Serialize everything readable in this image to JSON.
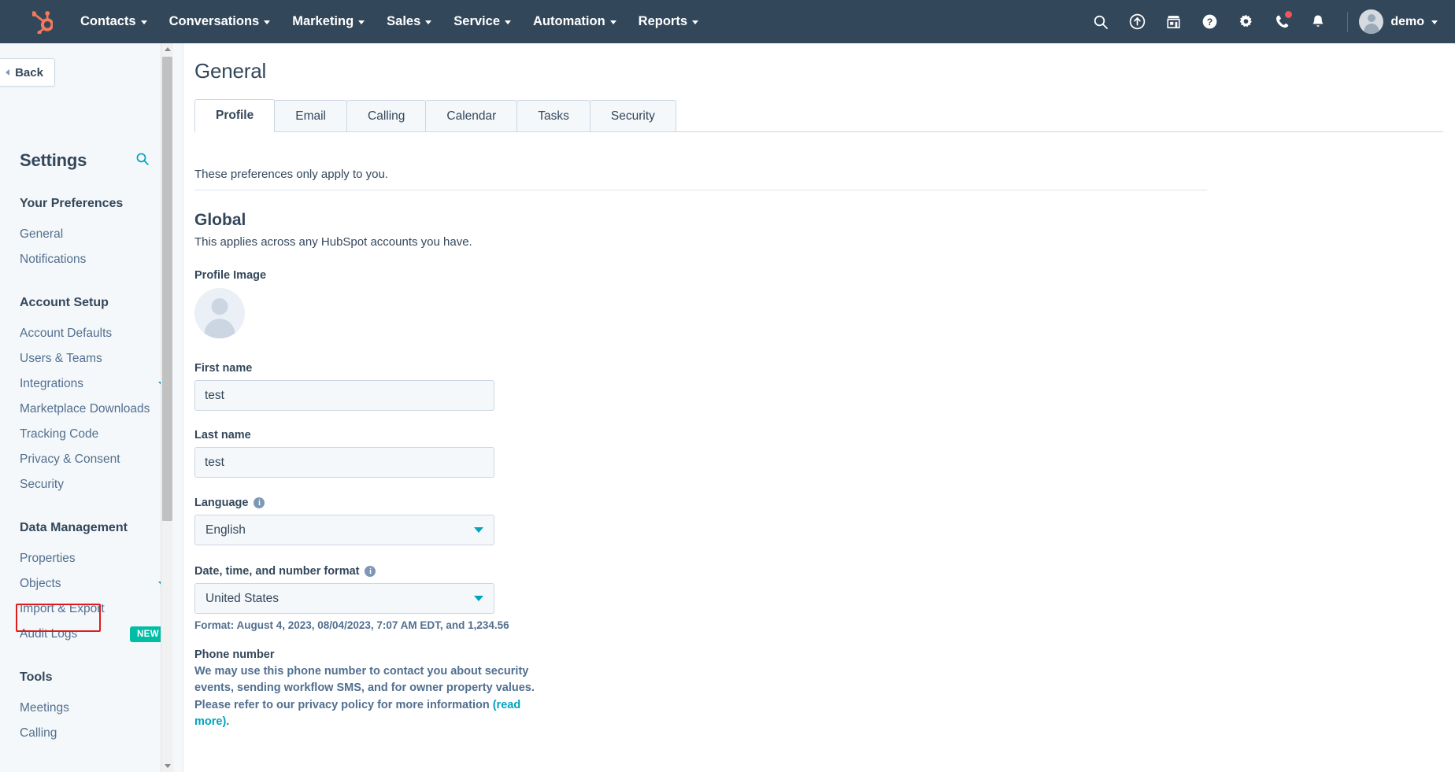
{
  "topnav": {
    "logo_icon": "hubspot-sprocket-logo",
    "items": [
      {
        "label": "Contacts",
        "icon": "chevron-down-icon"
      },
      {
        "label": "Conversations",
        "icon": "chevron-down-icon"
      },
      {
        "label": "Marketing",
        "icon": "chevron-down-icon"
      },
      {
        "label": "Sales",
        "icon": "chevron-down-icon"
      },
      {
        "label": "Service",
        "icon": "chevron-down-icon"
      },
      {
        "label": "Automation",
        "icon": "chevron-down-icon"
      },
      {
        "label": "Reports",
        "icon": "chevron-down-icon"
      }
    ],
    "right_icons": [
      {
        "name": "search-icon"
      },
      {
        "name": "upgrade-arrow-icon"
      },
      {
        "name": "marketplace-icon"
      },
      {
        "name": "help-icon"
      },
      {
        "name": "settings-gear-icon"
      },
      {
        "name": "calling-phone-icon",
        "badge": true
      },
      {
        "name": "notifications-bell-icon"
      }
    ],
    "user": {
      "name": "demo",
      "avatar": "user-avatar",
      "caret": "chevron-down-icon"
    }
  },
  "sidebar": {
    "back_label": "Back",
    "title": "Settings",
    "search_icon": "search-icon",
    "groups": [
      {
        "title": "Your Preferences",
        "items": [
          {
            "label": "General"
          },
          {
            "label": "Notifications"
          }
        ]
      },
      {
        "title": "Account Setup",
        "items": [
          {
            "label": "Account Defaults"
          },
          {
            "label": "Users & Teams"
          },
          {
            "label": "Integrations",
            "expandable": true
          },
          {
            "label": "Marketplace Downloads"
          },
          {
            "label": "Tracking Code"
          },
          {
            "label": "Privacy & Consent"
          },
          {
            "label": "Security"
          }
        ]
      },
      {
        "title": "Data Management",
        "items": [
          {
            "label": "Properties",
            "highlighted": true
          },
          {
            "label": "Objects",
            "expandable": true
          },
          {
            "label": "Import & Export"
          },
          {
            "label": "Audit Logs",
            "badge": "NEW"
          }
        ]
      },
      {
        "title": "Tools",
        "items": [
          {
            "label": "Meetings"
          },
          {
            "label": "Calling"
          }
        ]
      }
    ],
    "highlight_color": "#e01b1b",
    "badge_color": "#00bda5"
  },
  "main": {
    "page_title": "General",
    "tabs": [
      {
        "label": "Profile",
        "active": true
      },
      {
        "label": "Email",
        "active": false
      },
      {
        "label": "Calling",
        "active": false
      },
      {
        "label": "Calendar",
        "active": false
      },
      {
        "label": "Tasks",
        "active": false
      },
      {
        "label": "Security",
        "active": false
      }
    ],
    "subtext": "These preferences only apply to you.",
    "section": {
      "title": "Global",
      "subtitle": "This applies across any HubSpot accounts you have."
    },
    "fields": {
      "profile_image_label": "Profile Image",
      "first_name_label": "First name",
      "first_name_value": "test",
      "last_name_label": "Last name",
      "last_name_value": "test",
      "language_label": "Language",
      "language_value": "English",
      "date_format_label": "Date, time, and number format",
      "date_format_value": "United States",
      "format_note": "Format: August 4, 2023, 08/04/2023, 7:07 AM EDT, and 1,234.56",
      "phone_label": "Phone number",
      "phone_desc_1": "We may use this phone number to contact you about security events, sending workflow SMS, and for owner property values. Please refer to our privacy policy for more information ",
      "phone_read_more": "(read more)",
      "phone_desc_2": "."
    },
    "accent_color": "#00a4bd",
    "text_color": "#33475b"
  }
}
